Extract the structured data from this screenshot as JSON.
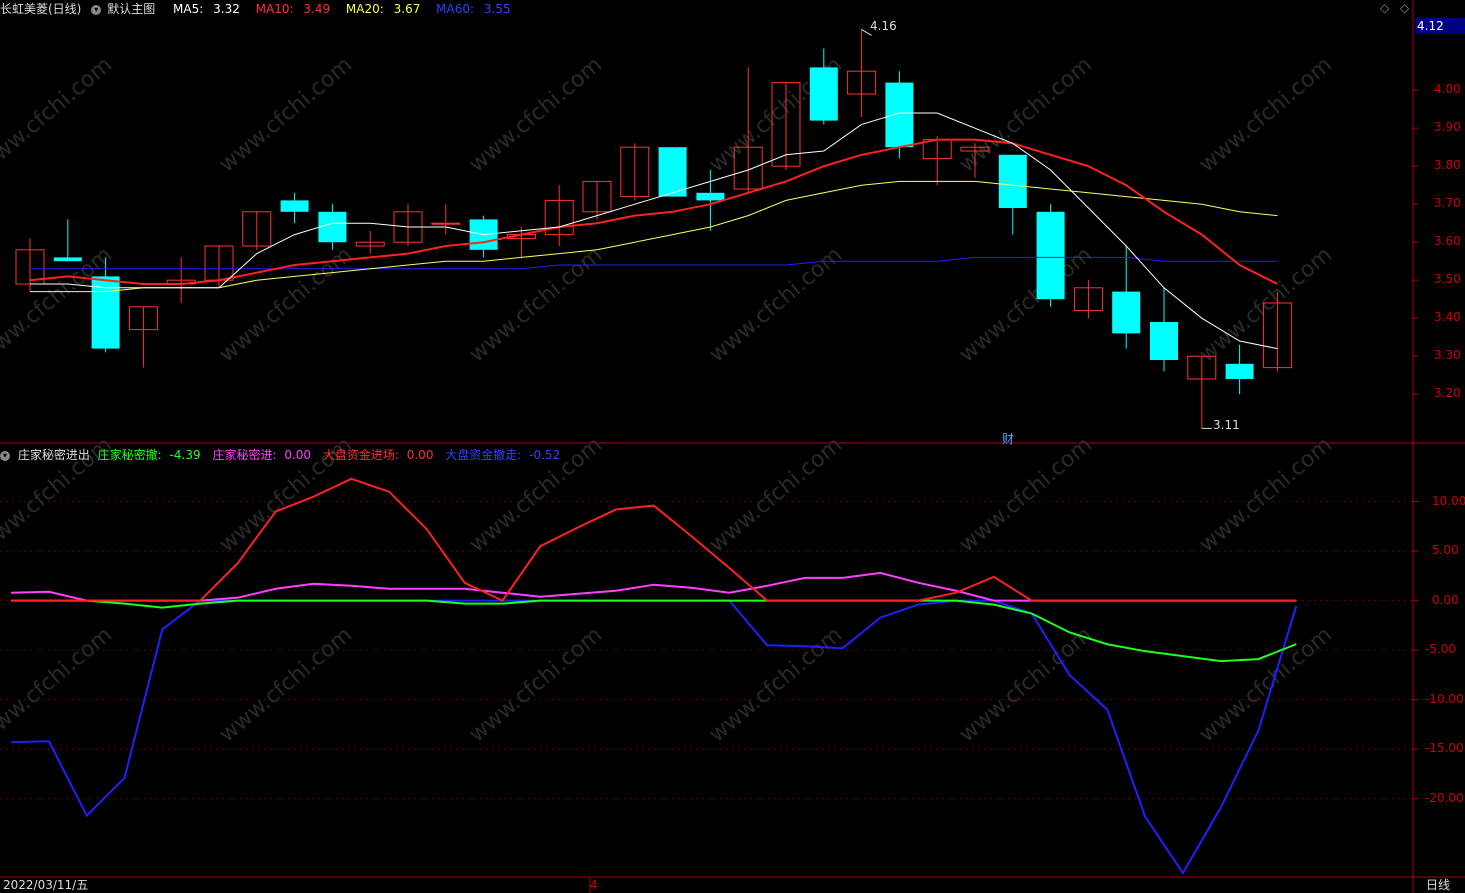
{
  "header": {
    "stock": "长虹美菱(日线)",
    "main_chart_label": "默认主图",
    "ma5_label": "MA5:",
    "ma5_value": "3.32",
    "ma10_label": "MA10:",
    "ma10_value": "3.49",
    "ma20_label": "MA20:",
    "ma20_value": "3.67",
    "ma60_label": "MA60:",
    "ma60_value": "3.55",
    "current_price": "4.12"
  },
  "indicator_header": {
    "name": "庄家秘密进出",
    "s1_label": "庄家秘密撤:",
    "s1_value": "-4.39",
    "s2_label": "庄家秘密进:",
    "s2_value": "0.00",
    "s3_label": "大盘资金进场:",
    "s3_value": "0.00",
    "s4_label": "大盘资金撤走:",
    "s4_value": "-0.52"
  },
  "annotations": {
    "high": "4.16",
    "low": "3.11",
    "marker": "财"
  },
  "footer": {
    "date": "2022/03/11/五",
    "month": "4",
    "period": "日线"
  },
  "watermark": "www.cfchi.com",
  "colors": {
    "up": "#ff3232",
    "down": "#00ffff",
    "ma5": "#ffffff",
    "ma10": "#ff2020",
    "ma20": "#ffff60",
    "ma60": "#2020ff",
    "s1": "#20ff20",
    "s2": "#ff40ff",
    "s3": "#ff2020",
    "s4": "#2020ff"
  },
  "chart_data": [
    {
      "type": "candlestick",
      "title": "长虹美菱(日线)",
      "yticks": [
        "4.00",
        "3.90",
        "3.80",
        "3.70",
        "3.60",
        "3.50",
        "3.40",
        "3.30",
        "3.20"
      ],
      "ylim": [
        3.09,
        4.19
      ],
      "candles": [
        {
          "o": 3.49,
          "h": 3.61,
          "l": 3.47,
          "c": 3.58
        },
        {
          "o": 3.56,
          "h": 3.66,
          "l": 3.55,
          "c": 3.55
        },
        {
          "o": 3.51,
          "h": 3.56,
          "l": 3.31,
          "c": 3.32
        },
        {
          "o": 3.37,
          "h": 3.43,
          "l": 3.27,
          "c": 3.43
        },
        {
          "o": 3.49,
          "h": 3.56,
          "l": 3.44,
          "c": 3.5
        },
        {
          "o": 3.5,
          "h": 3.59,
          "l": 3.48,
          "c": 3.59
        },
        {
          "o": 3.59,
          "h": 3.68,
          "l": 3.58,
          "c": 3.68
        },
        {
          "o": 3.71,
          "h": 3.73,
          "l": 3.65,
          "c": 3.68
        },
        {
          "o": 3.68,
          "h": 3.7,
          "l": 3.58,
          "c": 3.6
        },
        {
          "o": 3.59,
          "h": 3.63,
          "l": 3.57,
          "c": 3.6
        },
        {
          "o": 3.6,
          "h": 3.7,
          "l": 3.59,
          "c": 3.68
        },
        {
          "o": 3.65,
          "h": 3.7,
          "l": 3.62,
          "c": 3.65
        },
        {
          "o": 3.66,
          "h": 3.67,
          "l": 3.56,
          "c": 3.58
        },
        {
          "o": 3.61,
          "h": 3.64,
          "l": 3.56,
          "c": 3.62
        },
        {
          "o": 3.62,
          "h": 3.75,
          "l": 3.59,
          "c": 3.71
        },
        {
          "o": 3.68,
          "h": 3.76,
          "l": 3.66,
          "c": 3.76
        },
        {
          "o": 3.72,
          "h": 3.86,
          "l": 3.71,
          "c": 3.85
        },
        {
          "o": 3.85,
          "h": 3.85,
          "l": 3.72,
          "c": 3.72
        },
        {
          "o": 3.73,
          "h": 3.79,
          "l": 3.63,
          "c": 3.71
        },
        {
          "o": 3.74,
          "h": 4.06,
          "l": 3.73,
          "c": 3.85
        },
        {
          "o": 3.8,
          "h": 4.02,
          "l": 3.79,
          "c": 4.02
        },
        {
          "o": 4.06,
          "h": 4.11,
          "l": 3.91,
          "c": 3.92
        },
        {
          "o": 3.99,
          "h": 4.16,
          "l": 3.93,
          "c": 4.05
        },
        {
          "o": 4.02,
          "h": 4.05,
          "l": 3.82,
          "c": 3.85
        },
        {
          "o": 3.82,
          "h": 3.88,
          "l": 3.75,
          "c": 3.87
        },
        {
          "o": 3.84,
          "h": 3.86,
          "l": 3.77,
          "c": 3.85
        },
        {
          "o": 3.83,
          "h": 3.83,
          "l": 3.62,
          "c": 3.69
        },
        {
          "o": 3.68,
          "h": 3.7,
          "l": 3.43,
          "c": 3.45
        },
        {
          "o": 3.42,
          "h": 3.5,
          "l": 3.4,
          "c": 3.48
        },
        {
          "o": 3.47,
          "h": 3.59,
          "l": 3.32,
          "c": 3.36
        },
        {
          "o": 3.39,
          "h": 3.48,
          "l": 3.26,
          "c": 3.29
        },
        {
          "o": 3.24,
          "h": 3.3,
          "l": 3.11,
          "c": 3.3
        },
        {
          "o": 3.28,
          "h": 3.33,
          "l": 3.2,
          "c": 3.24
        },
        {
          "o": 3.27,
          "h": 3.47,
          "l": 3.26,
          "c": 3.44
        }
      ],
      "ma5": [
        3.49,
        3.49,
        3.48,
        3.48,
        3.48,
        3.48,
        3.57,
        3.62,
        3.65,
        3.65,
        3.64,
        3.64,
        3.62,
        3.63,
        3.64,
        3.67,
        3.7,
        3.73,
        3.76,
        3.79,
        3.83,
        3.84,
        3.91,
        3.94,
        3.94,
        3.9,
        3.86,
        3.79,
        3.69,
        3.59,
        3.48,
        3.4,
        3.34,
        3.32
      ],
      "ma10": [
        3.5,
        3.51,
        3.5,
        3.49,
        3.49,
        3.5,
        3.52,
        3.54,
        3.55,
        3.56,
        3.57,
        3.59,
        3.6,
        3.62,
        3.64,
        3.65,
        3.67,
        3.68,
        3.7,
        3.73,
        3.76,
        3.8,
        3.83,
        3.85,
        3.87,
        3.87,
        3.86,
        3.83,
        3.8,
        3.75,
        3.68,
        3.62,
        3.54,
        3.49
      ],
      "ma20": [
        3.47,
        3.47,
        3.47,
        3.48,
        3.48,
        3.48,
        3.5,
        3.51,
        3.52,
        3.53,
        3.54,
        3.55,
        3.55,
        3.56,
        3.57,
        3.58,
        3.6,
        3.62,
        3.64,
        3.67,
        3.71,
        3.73,
        3.75,
        3.76,
        3.76,
        3.76,
        3.75,
        3.74,
        3.73,
        3.72,
        3.71,
        3.7,
        3.68,
        3.67
      ],
      "ma60": [
        3.53,
        3.53,
        3.53,
        3.53,
        3.53,
        3.53,
        3.53,
        3.53,
        3.53,
        3.53,
        3.53,
        3.53,
        3.53,
        3.53,
        3.54,
        3.54,
        3.54,
        3.54,
        3.54,
        3.54,
        3.54,
        3.55,
        3.55,
        3.55,
        3.55,
        3.56,
        3.56,
        3.56,
        3.56,
        3.56,
        3.55,
        3.55,
        3.55,
        3.55
      ]
    },
    {
      "type": "line",
      "title": "庄家秘密进出",
      "yticks": [
        "10.00",
        "5.00",
        "0.00",
        "-5.00",
        "-10.00",
        "-15.00",
        "-20.00"
      ],
      "ylim": [
        -27.5,
        14
      ],
      "series": [
        {
          "name": "庄家秘密撤",
          "values": [
            0,
            0,
            0,
            -0.3,
            -0.7,
            -0.3,
            0,
            0,
            0,
            0,
            0,
            0,
            -0.3,
            -0.3,
            0,
            0,
            0,
            0,
            0,
            0,
            0,
            0,
            0,
            0,
            0,
            0,
            -0.4,
            -1.3,
            -3.2,
            -4.4,
            -5.1,
            -5.6,
            -6.1,
            -5.9,
            -4.39
          ]
        },
        {
          "name": "庄家秘密进",
          "values": [
            0.8,
            0.9,
            0,
            0,
            0,
            0,
            0.3,
            1.2,
            1.7,
            1.5,
            1.2,
            1.2,
            1.2,
            0.8,
            0.4,
            0.7,
            1.0,
            1.6,
            1.3,
            0.8,
            1.5,
            2.3,
            2.3,
            2.8,
            1.8,
            1.0,
            0,
            0,
            0,
            0,
            0,
            0,
            0,
            0,
            0
          ]
        },
        {
          "name": "大盘资金进场",
          "values": [
            0,
            0,
            0,
            0,
            0,
            0,
            3.8,
            9.0,
            10.5,
            12.3,
            11.0,
            7.2,
            1.8,
            0,
            5.5,
            7.4,
            9.2,
            9.6,
            6.5,
            3.3,
            0,
            0,
            0,
            0,
            0,
            0.8,
            2.4,
            0,
            0,
            0,
            0,
            0,
            0,
            0,
            0
          ]
        },
        {
          "name": "大盘资金撤走",
          "values": [
            -14.3,
            -14.2,
            -21.7,
            -17.9,
            -2.9,
            0,
            0,
            0,
            0,
            0,
            0,
            0,
            0,
            0,
            0,
            0,
            0,
            0,
            0,
            0,
            -4.5,
            -4.6,
            -4.8,
            -1.7,
            -0.4,
            0,
            0,
            -1.3,
            -7.5,
            -11.0,
            -21.8,
            -27.5,
            -20.9,
            -13.1,
            -0.52
          ]
        }
      ]
    }
  ]
}
